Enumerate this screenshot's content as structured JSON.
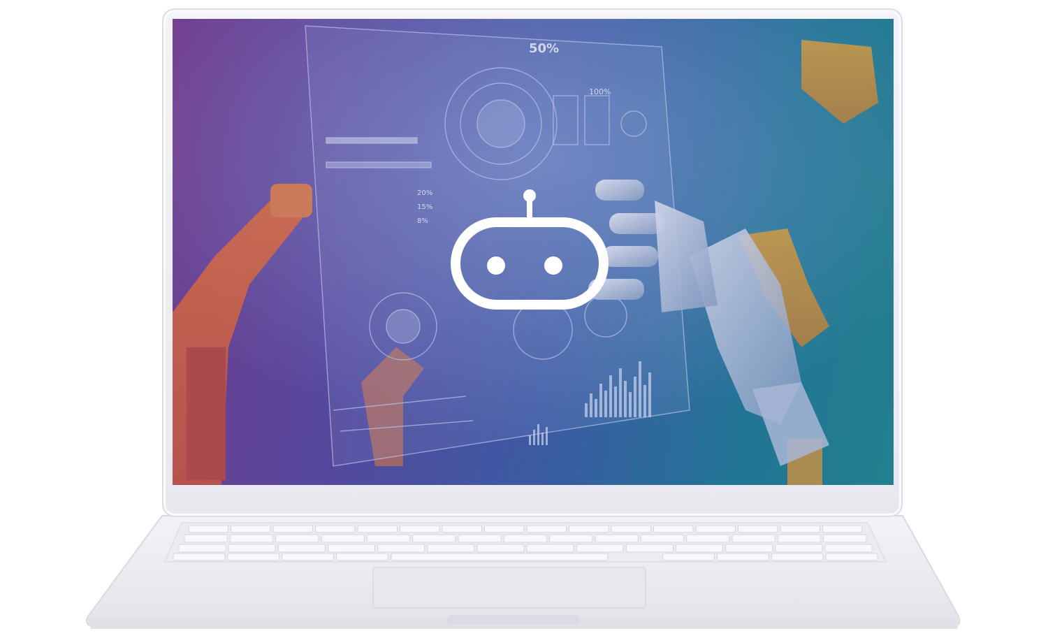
{
  "screen_texts": {
    "pct_top": "50%",
    "pct_100": "100%",
    "pct_20": "20%",
    "pct_15": "15%",
    "pct_8": "8%"
  },
  "icons": {
    "center": "robot-head-icon"
  },
  "colors": {
    "screen_left": "#7b3f8f",
    "screen_mid": "#3c5fa6",
    "screen_right": "#1f8a8d",
    "robot_arm_orange": "#e8742f",
    "robot_arm_yellow": "#e0a437",
    "icon": "#ffffff"
  }
}
